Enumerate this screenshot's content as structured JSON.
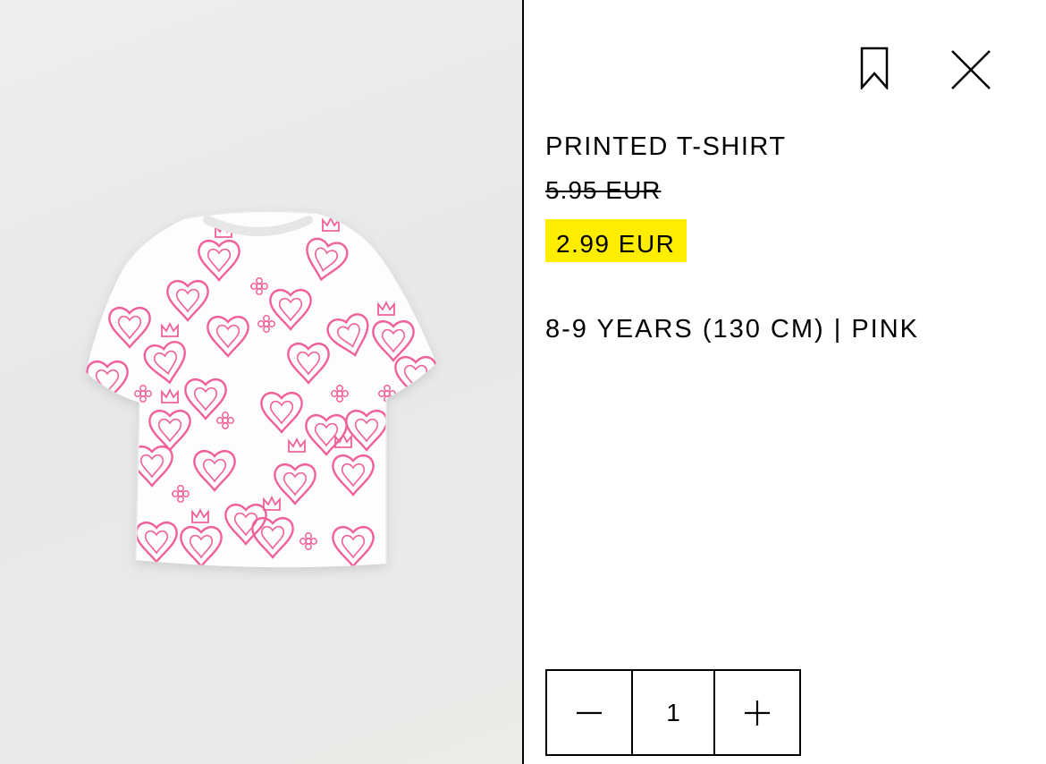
{
  "product": {
    "image_alt": "Printed T-shirt",
    "title": "PRINTED T-SHIRT",
    "original_price": "5.95 EUR",
    "sale_price": "2.99 EUR",
    "variant": "8-9 YEARS (130 CM) | PINK"
  },
  "quantity": {
    "value": "1",
    "decrement_icon": "minus-icon",
    "increment_icon": "plus-icon"
  },
  "actions": {
    "bookmark_icon": "bookmark-icon",
    "close_icon": "close-icon"
  },
  "colors": {
    "sale_highlight": "#ffed00",
    "print_pink": "#f0609a",
    "image_background": "#e8e9eb"
  }
}
